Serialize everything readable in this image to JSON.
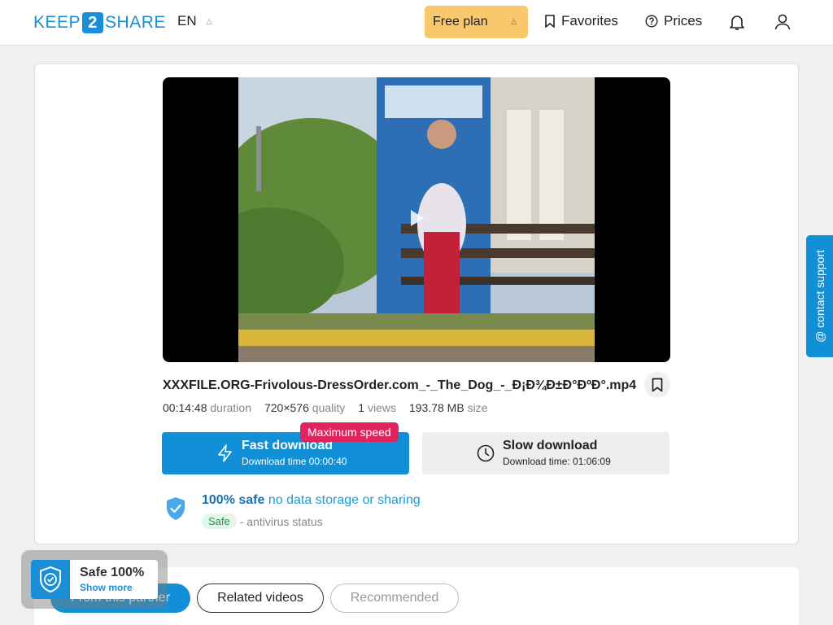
{
  "header": {
    "logo": {
      "left": "KEEP",
      "middle": "2",
      "right": "SHARE"
    },
    "language": "EN",
    "plan_label": "Free plan",
    "favorites_label": "Favorites",
    "prices_label": "Prices"
  },
  "file": {
    "name": "XXXFILE.ORG-Frivolous-DressOrder.com_-_The_Dog_-_Ð¡Ð¾Ð±Ð°ÐºÐ°.mp4",
    "duration_value": "00:14:48",
    "duration_label": "duration",
    "quality_value": "720×576",
    "quality_label": "quality",
    "views_value": "1",
    "views_label": "views",
    "size_value": "193.78 MB",
    "size_label": "size"
  },
  "downloads": {
    "fast_title": "Fast download",
    "fast_sub": "Download time 00:00:40",
    "fast_badge": "Maximum speed",
    "slow_title": "Slow download",
    "slow_sub": "Download time: 01:06:09"
  },
  "safety": {
    "headline_strong": "100% safe",
    "headline_rest": "no data storage or sharing",
    "pill": "Safe",
    "status_text": "- antivirus status"
  },
  "tabs": {
    "partner": "From this partner",
    "related": "Related videos",
    "recommended": "Recommended"
  },
  "safe_widget": {
    "title": "Safe 100%",
    "more": "Show more"
  },
  "support_label": "@ contact support",
  "colors": {
    "brand_blue": "#1190d8",
    "plan_yellow": "#f9c76c",
    "badge_red": "#e0245e",
    "safe_green": "#2e8a55"
  }
}
